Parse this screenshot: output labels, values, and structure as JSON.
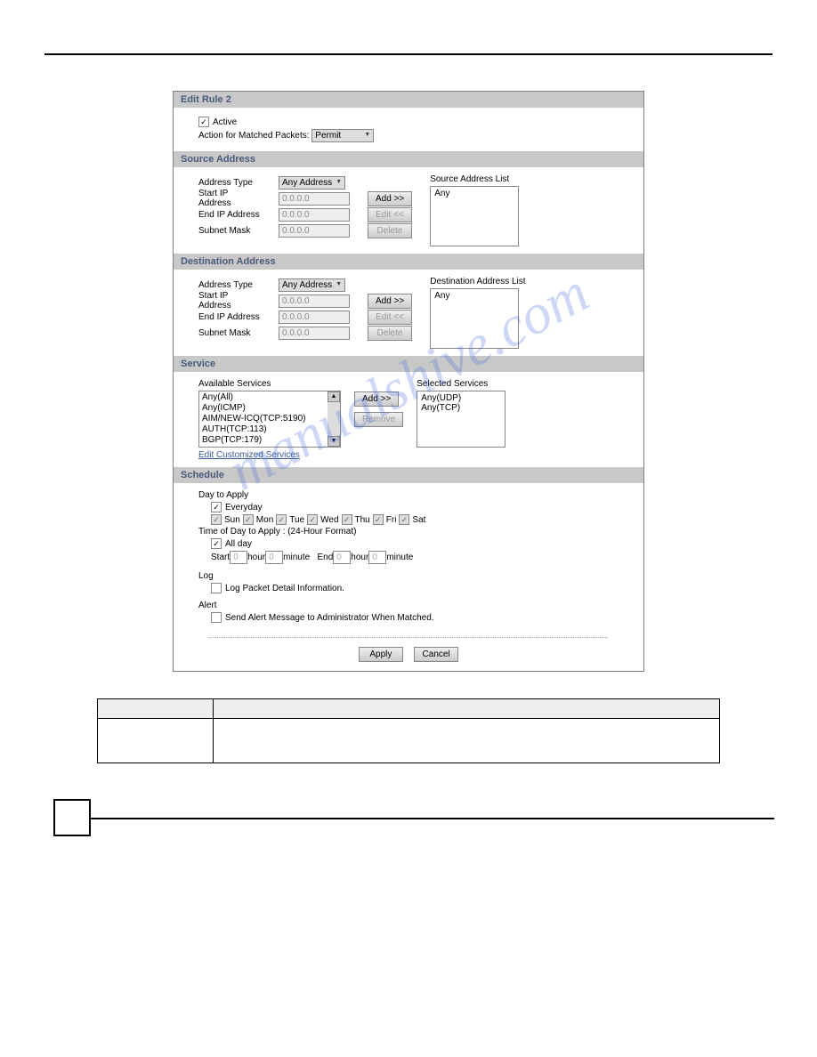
{
  "headers": {
    "edit_rule": "Edit Rule 2",
    "source": "Source Address",
    "dest": "Destination Address",
    "service": "Service",
    "schedule": "Schedule"
  },
  "rule": {
    "active_label": "Active",
    "action_label": "Action for Matched Packets:",
    "action_value": "Permit"
  },
  "addr": {
    "type_label": "Address Type",
    "type_value": "Any Address",
    "start_ip_label": "Start IP Address",
    "end_ip_label": "End IP Address",
    "subnet_label": "Subnet Mask",
    "ip_placeholder": "0.0.0.0",
    "add_btn": "Add >>",
    "edit_btn": "Edit <<",
    "delete_btn": "Delete",
    "src_list_title": "Source Address List",
    "dst_list_title": "Destination Address List",
    "any": "Any"
  },
  "service": {
    "avail_label": "Available Services",
    "selected_label": "Selected Services",
    "items": [
      "Any(All)",
      "Any(ICMP)",
      "AIM/NEW-ICQ(TCP:5190)",
      "AUTH(TCP:113)",
      "BGP(TCP:179)"
    ],
    "selected": [
      "Any(UDP)",
      "Any(TCP)"
    ],
    "add_btn": "Add >>",
    "remove_btn": "Remove",
    "custom_link": "Edit Customized Services"
  },
  "schedule": {
    "day_label": "Day to Apply",
    "everyday": "Everyday",
    "days": [
      "Sun",
      "Mon",
      "Tue",
      "Wed",
      "Thu",
      "Fri",
      "Sat"
    ],
    "time_label": "Time of Day to Apply : (24-Hour Format)",
    "allday": "All day",
    "start": "Start",
    "end": "End",
    "hour": "hour",
    "minute": "minute",
    "time_val": "0",
    "log_label": "Log",
    "log_detail": "Log Packet Detail Information.",
    "alert_label": "Alert",
    "alert_detail": "Send Alert Message to Administrator When Matched."
  },
  "buttons": {
    "apply": "Apply",
    "cancel": "Cancel"
  },
  "watermark": "manualshive.com"
}
